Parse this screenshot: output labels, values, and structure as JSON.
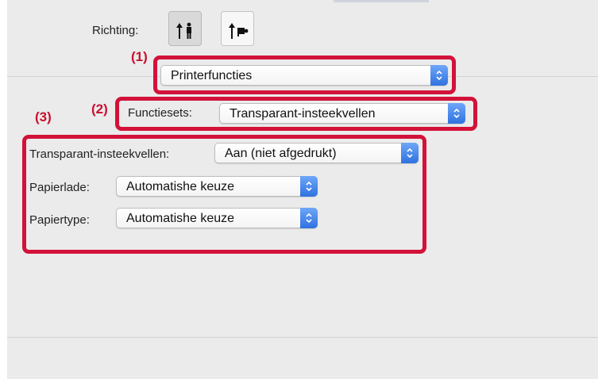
{
  "orientation": {
    "label": "Richting:",
    "options": [
      {
        "name": "portrait-icon",
        "selected": true
      },
      {
        "name": "landscape-icon",
        "selected": false
      }
    ]
  },
  "annotations": {
    "one": "(1)",
    "two": "(2)",
    "three": "(3)"
  },
  "section_menu": {
    "value": "Printerfuncties"
  },
  "feature_sets": {
    "label": "Functiesets:",
    "value": "Transparant-insteekvellen"
  },
  "options": {
    "transparency": {
      "label": "Transparant-insteekvellen:",
      "value": "Aan (niet afgedrukt)"
    },
    "paper_tray": {
      "label": "Papierlade:",
      "value": "Automatishe keuze"
    },
    "paper_type": {
      "label": "Papiertype:",
      "value": "Automatishe keuze"
    }
  },
  "colors": {
    "highlight": "#d2123a",
    "panel": "#ebebeb",
    "stepper": "#2f72e0"
  }
}
